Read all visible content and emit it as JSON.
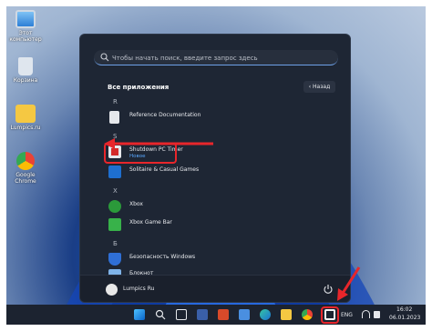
{
  "desktop": {
    "icons": [
      {
        "label": "Этот компьютер",
        "icon": "monitor-icon"
      },
      {
        "label": "Корзина",
        "icon": "recycle-bin-icon"
      },
      {
        "label": "Lumpics.ru",
        "icon": "folder-icon"
      },
      {
        "label": "Google Chrome",
        "icon": "chrome-icon"
      }
    ]
  },
  "start_menu": {
    "search_placeholder": "Чтобы начать поиск, введите запрос здесь",
    "section_title": "Все приложения",
    "back_label": "Назад",
    "groups": [
      {
        "letter": "R",
        "apps": [
          {
            "name": "Reference Documentation",
            "sub": "",
            "icon": "document-icon"
          }
        ]
      },
      {
        "letter": "S",
        "apps": [
          {
            "name": "Shutdown PC Timer",
            "sub": "Новое",
            "icon": "shutdown-timer-icon"
          },
          {
            "name": "Solitaire & Casual Games",
            "sub": "",
            "icon": "cards-icon"
          }
        ]
      },
      {
        "letter": "X",
        "apps": [
          {
            "name": "Xbox",
            "sub": "",
            "icon": "xbox-icon"
          },
          {
            "name": "Xbox Game Bar",
            "sub": "",
            "icon": "game-bar-icon"
          }
        ]
      },
      {
        "letter": "Б",
        "apps": [
          {
            "name": "Безопасность Windows",
            "sub": "",
            "icon": "shield-icon"
          },
          {
            "name": "Блокнот",
            "sub": "",
            "icon": "notepad-icon"
          }
        ]
      }
    ],
    "user_name": "Lumpics Ru"
  },
  "taskbar": {
    "language": "ENG",
    "time": "16:02",
    "date": "06.01.2023"
  },
  "colors": {
    "accent": "#e8262b",
    "link": "#5aa9ff",
    "menu_bg": "#1e2634"
  }
}
